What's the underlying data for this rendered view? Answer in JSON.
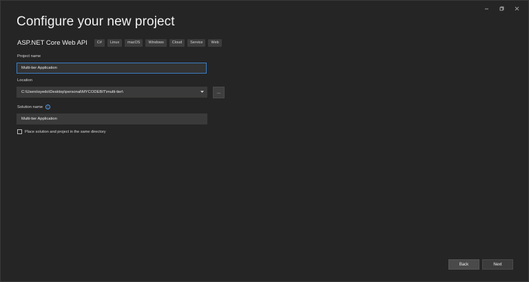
{
  "window": {
    "controls": [
      "minimize-icon",
      "restore-icon",
      "close-icon"
    ]
  },
  "header": {
    "title": "Configure your new project"
  },
  "template": {
    "name": "ASP.NET Core Web API",
    "tags": [
      "C#",
      "Linux",
      "macOS",
      "Windows",
      "Cloud",
      "Service",
      "Web"
    ]
  },
  "project_name": {
    "label": "Project name",
    "value": "Multi-tier Application"
  },
  "location": {
    "label": "Location",
    "value": "C:\\Users\\syedo\\Desktop\\personal\\MYCODEBIT\\multi-tier\\",
    "browse_label": "..."
  },
  "solution_name": {
    "label": "Solution name",
    "value": "Multi-tier Application",
    "info_glyph": "i"
  },
  "same_directory": {
    "label": "Place solution and project in the same directory",
    "checked": false
  },
  "footer": {
    "back_label": "Back",
    "next_label": "Next"
  }
}
